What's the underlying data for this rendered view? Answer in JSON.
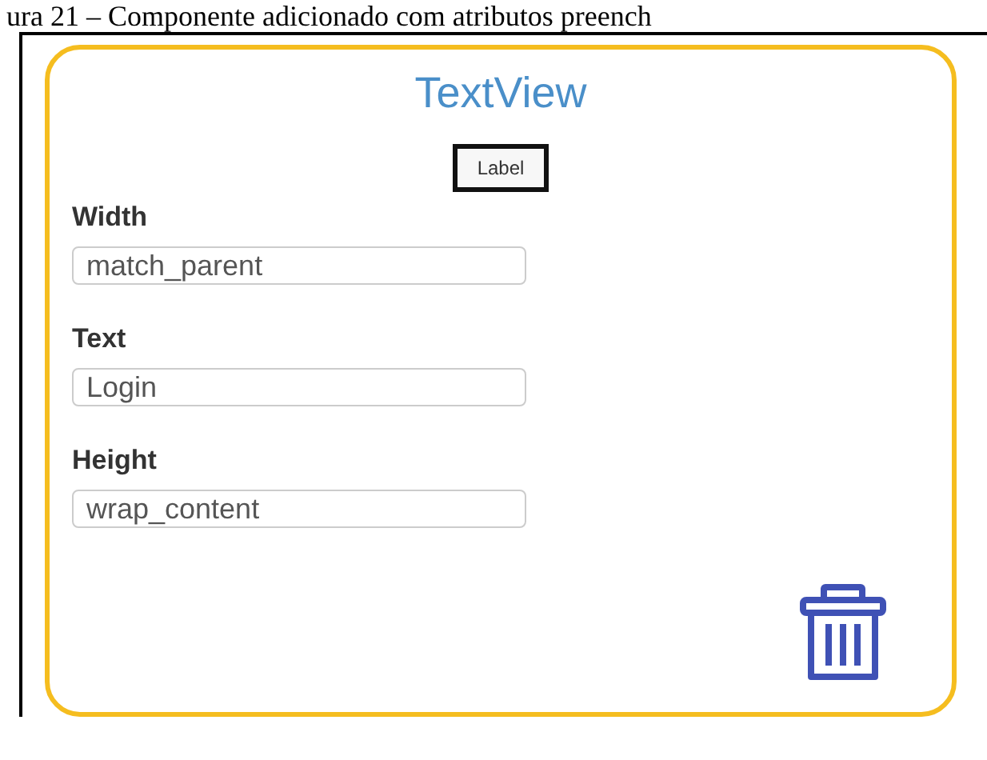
{
  "caption": "ura 21 – Componente adicionado com atributos preench",
  "component": {
    "title": "TextView",
    "preview_label": "Label",
    "fields": [
      {
        "label": "Width",
        "value": "match_parent"
      },
      {
        "label": "Text",
        "value": "Login"
      },
      {
        "label": "Height",
        "value": "wrap_content"
      }
    ]
  }
}
